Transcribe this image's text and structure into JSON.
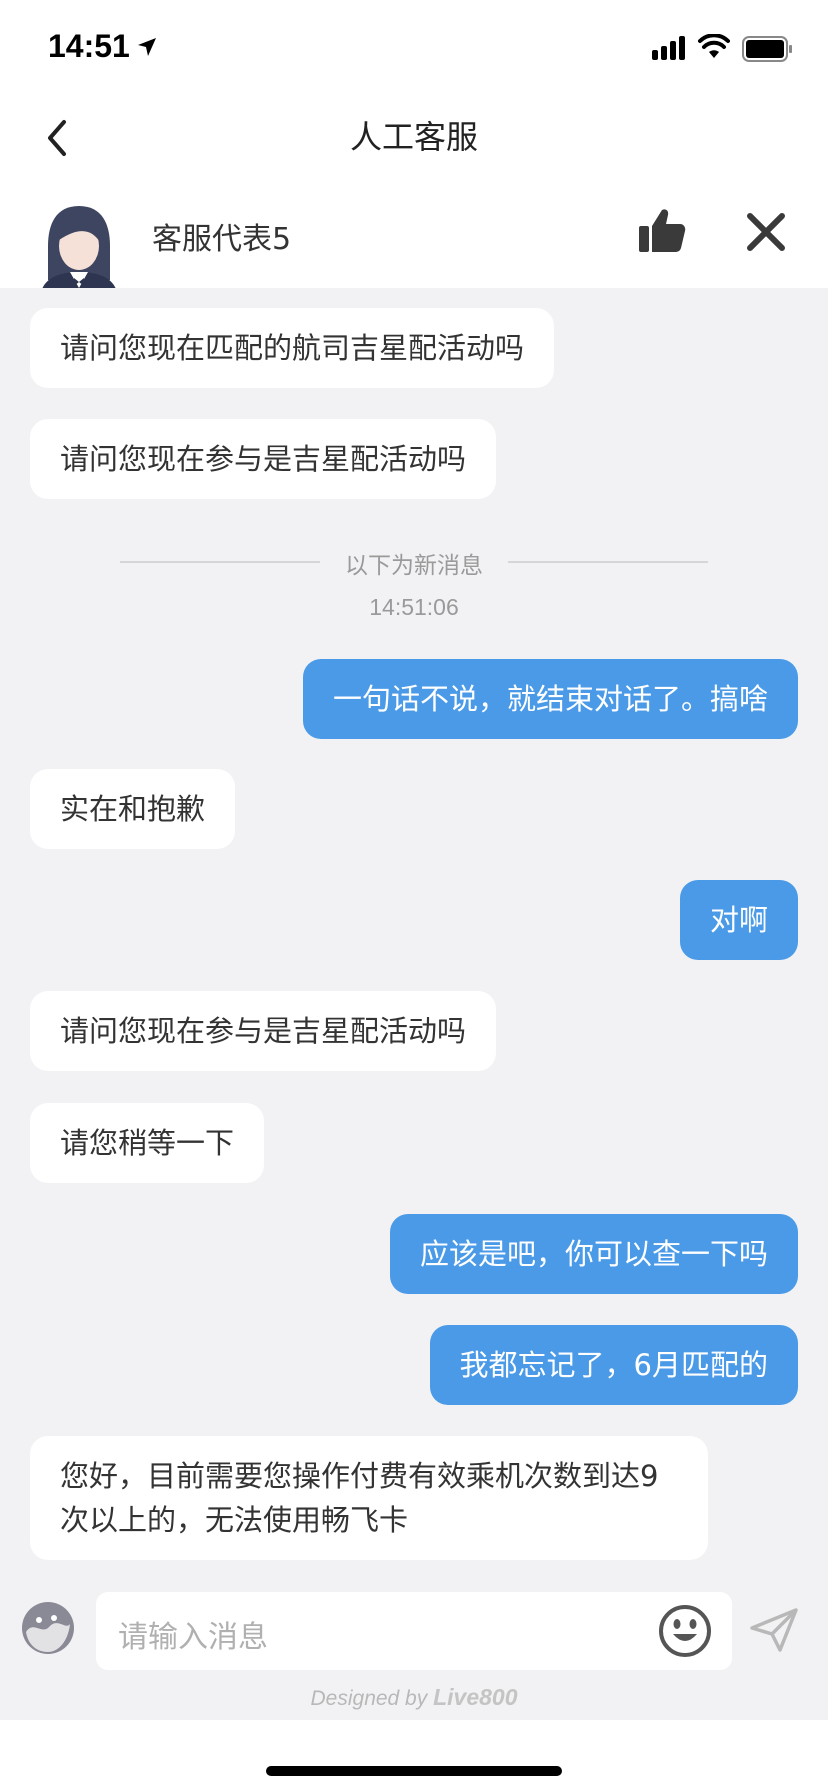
{
  "status_bar": {
    "time": "14:51"
  },
  "nav": {
    "title": "人工客服"
  },
  "agent": {
    "name": "客服代表5"
  },
  "chat": {
    "divider_label": "以下为新消息",
    "timestamp": "14:51:06",
    "messages": [
      {
        "side": "in",
        "text": "请问您现在匹配的航司吉星配活动吗"
      },
      {
        "side": "in",
        "text": "请问您现在参与是吉星配活动吗"
      },
      {
        "side": "out",
        "text": "一句话不说，就结束对话了。搞啥"
      },
      {
        "side": "in",
        "text": "实在和抱歉"
      },
      {
        "side": "out",
        "text": "对啊"
      },
      {
        "side": "in",
        "text": "请问您现在参与是吉星配活动吗"
      },
      {
        "side": "in",
        "text": "请您稍等一下"
      },
      {
        "side": "out",
        "text": "应该是吧，你可以查一下吗"
      },
      {
        "side": "out",
        "text": "我都忘记了，6月匹配的"
      },
      {
        "side": "in",
        "text": "您好，目前需要您操作付费有效乘机次数到达9次以上的，无法使用畅飞卡"
      }
    ]
  },
  "input": {
    "placeholder": "请输入消息"
  },
  "footer": {
    "designed_by": "Designed by",
    "brand": "Live800"
  },
  "colors": {
    "outgoing_bubble": "#4a9ae8",
    "incoming_bubble": "#ffffff",
    "chat_background": "#f2f2f4"
  },
  "icons": [
    "location-arrow-icon",
    "signal-icon",
    "wifi-icon",
    "battery-icon",
    "back-chevron-icon",
    "agent-avatar",
    "thumbs-up-icon",
    "close-icon",
    "mascot-icon",
    "emoji-icon",
    "send-icon"
  ]
}
